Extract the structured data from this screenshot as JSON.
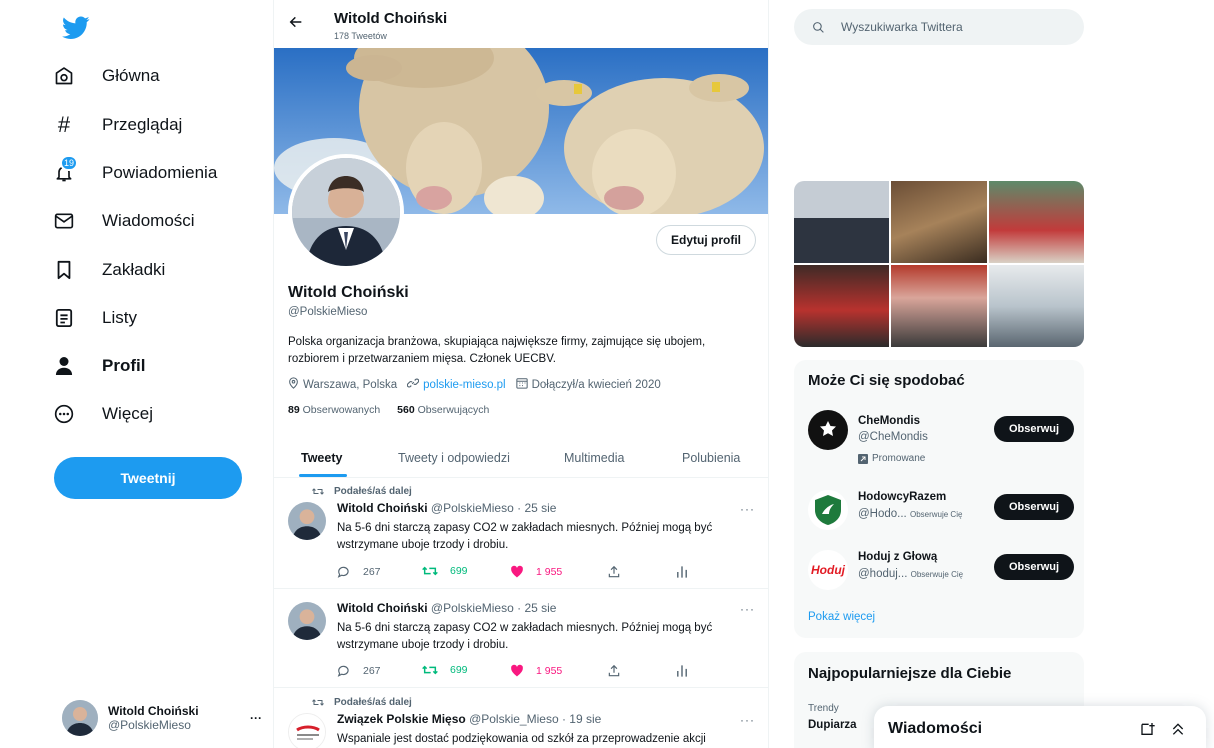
{
  "nav": {
    "items": [
      {
        "label": "Główna",
        "icon": "home-icon"
      },
      {
        "label": "Przeglądaj",
        "icon": "hashtag-icon"
      },
      {
        "label": "Powiadomienia",
        "icon": "bell-icon",
        "badge": "19"
      },
      {
        "label": "Wiadomości",
        "icon": "mail-icon"
      },
      {
        "label": "Zakładki",
        "icon": "bookmark-icon"
      },
      {
        "label": "Listy",
        "icon": "list-icon"
      },
      {
        "label": "Profil",
        "icon": "profile-icon"
      },
      {
        "label": "Więcej",
        "icon": "more-icon"
      }
    ],
    "tweet_button": "Tweetnij",
    "account": {
      "name": "Witold Choiński",
      "handle": "@PolskieMieso",
      "more": "···"
    }
  },
  "header": {
    "title": "Witold Choiński",
    "subtitle": "178 Tweetów"
  },
  "profile": {
    "edit_button": "Edytuj profil",
    "name": "Witold Choiński",
    "handle": "@PolskieMieso",
    "bio": "Polska organizacja branżowa, skupiająca największe firmy, zajmujące się ubojem, rozbiorem i przetwarzaniem mięsa. Członek UECBV.",
    "location": "Warszawa, Polska",
    "website": "polskie-mieso.pl",
    "joined": "Dołączył/a kwiecień 2020",
    "following_count": "89",
    "following_label": "Obserwowanych",
    "followers_count": "560",
    "followers_label": "Obserwujących"
  },
  "tabs": [
    "Tweety",
    "Tweety i odpowiedzi",
    "Multimedia",
    "Polubienia"
  ],
  "tweets": [
    {
      "retweeted": "Podałeś/aś dalej",
      "name": "Witold Choiński",
      "handle": "@PolskieMieso · 25 sie",
      "text": "Na 5-6 dni starczą zapasy CO2 w zakładach miesnych. Później mogą być wstrzymane uboje trzody i drobiu.",
      "replies": "267",
      "retweets": "699",
      "likes": "1 955",
      "more": "···"
    },
    {
      "retweeted": "",
      "name": "Witold Choiński",
      "handle": "@PolskieMieso · 25 sie",
      "text": "Na 5-6 dni starczą zapasy CO2 w zakładach miesnych. Później mogą być wstrzymane uboje trzody i drobiu.",
      "replies": "267",
      "retweets": "699",
      "likes": "1 955",
      "more": "···"
    },
    {
      "retweeted": "Podałeś/aś dalej",
      "name": "Związek Polskie Mięso",
      "handle": "@Polskie_Mieso · 19 sie",
      "text": "Wspaniale jest dostać podziękowania od szkół za przeprowadzenie akcji",
      "more": "···"
    }
  ],
  "right": {
    "search_placeholder": "Wyszukiwarka Twittera",
    "wtf_title": "Może Ci się spodobać",
    "wtf": [
      {
        "name": "CheMondis",
        "handle": "@CheMondis",
        "promoted": "Promowane",
        "button": "Obserwuj"
      },
      {
        "name": "HodowcyRazem",
        "handle": "@Hodo...",
        "follows_you": "Obserwuje Cię",
        "button": "Obserwuj"
      },
      {
        "name": "Hoduj z Głową",
        "handle": "@hoduj...",
        "follows_you": "Obserwuje Cię",
        "button": "Obserwuj",
        "logo_text": "Hoduj"
      }
    ],
    "show_more": "Pokaż więcej",
    "trends_title": "Najpopularniejsze dla Ciebie",
    "trend_meta": "Trendy",
    "trend_name": "Dupiarza"
  },
  "dm_drawer": {
    "title": "Wiadomości"
  },
  "colors": {
    "accent": "#1d9bf0",
    "like": "#f91880",
    "retweet": "#00ba7c",
    "text": "#0f1419",
    "muted": "#536471"
  }
}
